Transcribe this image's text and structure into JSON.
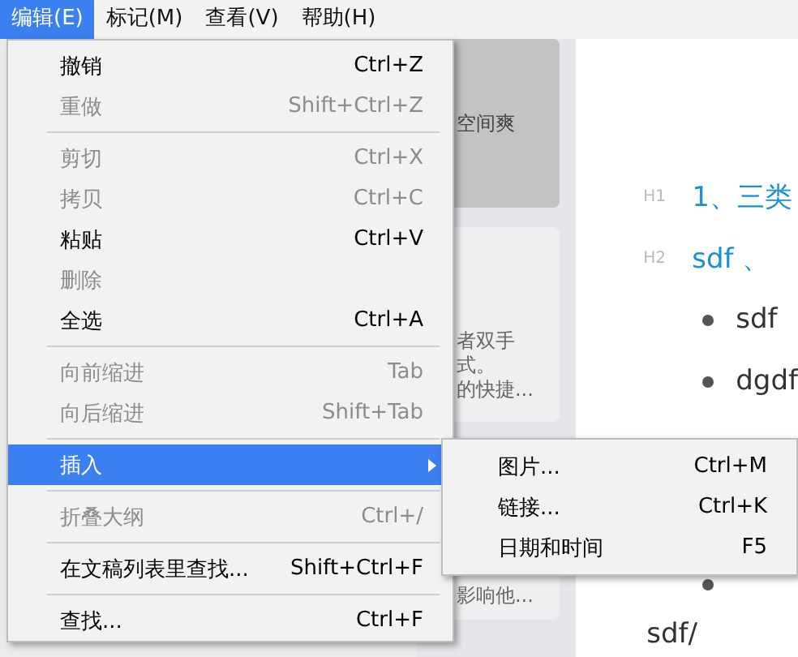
{
  "menubar": [
    {
      "label": "编辑(E)",
      "selected": true
    },
    {
      "label": "标记(M)",
      "selected": false
    },
    {
      "label": "查看(V)",
      "selected": false
    },
    {
      "label": "帮助(H)",
      "selected": false
    }
  ],
  "cards": [
    {
      "lines": [
        "空间爽"
      ],
      "selected": true
    },
    {
      "lines": [
        "者双手",
        "式。",
        "的快捷..."
      ],
      "selected": false
    },
    {
      "lines": [
        "影响他..."
      ],
      "selected": false
    }
  ],
  "editor": [
    {
      "kind": "heading",
      "level_label": "H1",
      "text": "1、三类"
    },
    {
      "kind": "heading",
      "level_label": "H2",
      "text": "sdf 、"
    },
    {
      "kind": "bullet",
      "text": "sdf"
    },
    {
      "kind": "bullet",
      "text": "dgdf"
    },
    {
      "kind": "gap"
    },
    {
      "kind": "bullet"
    },
    {
      "kind": "paragraph",
      "text": "sdf/"
    }
  ],
  "menu": [
    {
      "kind": "item",
      "label": "撤销",
      "shortcut": "Ctrl+Z",
      "disabled": false,
      "selected": false
    },
    {
      "kind": "item",
      "label": "重做",
      "shortcut": "Shift+Ctrl+Z",
      "disabled": true,
      "selected": false
    },
    {
      "kind": "separator"
    },
    {
      "kind": "item",
      "label": "剪切",
      "shortcut": "Ctrl+X",
      "disabled": true,
      "selected": false
    },
    {
      "kind": "item",
      "label": "拷贝",
      "shortcut": "Ctrl+C",
      "disabled": true,
      "selected": false
    },
    {
      "kind": "item",
      "label": "粘贴",
      "shortcut": "Ctrl+V",
      "disabled": false,
      "selected": false
    },
    {
      "kind": "item",
      "label": "删除",
      "disabled": true,
      "selected": false
    },
    {
      "kind": "item",
      "label": "全选",
      "shortcut": "Ctrl+A",
      "disabled": false,
      "selected": false
    },
    {
      "kind": "separator"
    },
    {
      "kind": "item",
      "label": "向前缩进",
      "shortcut": "Tab",
      "disabled": true,
      "selected": false
    },
    {
      "kind": "item",
      "label": "向后缩进",
      "shortcut": "Shift+Tab",
      "disabled": true,
      "selected": false
    },
    {
      "kind": "separator"
    },
    {
      "kind": "submenu",
      "label": "插入",
      "disabled": false,
      "selected": true
    },
    {
      "kind": "separator"
    },
    {
      "kind": "item",
      "label": "折叠大纲",
      "shortcut": "Ctrl+/",
      "disabled": true,
      "selected": false
    },
    {
      "kind": "separator"
    },
    {
      "kind": "item",
      "label": "在文稿列表里查找...",
      "shortcut": "Shift+Ctrl+F",
      "disabled": false,
      "selected": false
    },
    {
      "kind": "separator"
    },
    {
      "kind": "item",
      "label": "查找...",
      "shortcut": "Ctrl+F",
      "disabled": false,
      "selected": false
    }
  ],
  "submenu": [
    {
      "label": "图片...",
      "shortcut": "Ctrl+M"
    },
    {
      "label": "链接...",
      "shortcut": "Ctrl+K"
    },
    {
      "label": "日期和时间",
      "shortcut": "F5"
    }
  ]
}
